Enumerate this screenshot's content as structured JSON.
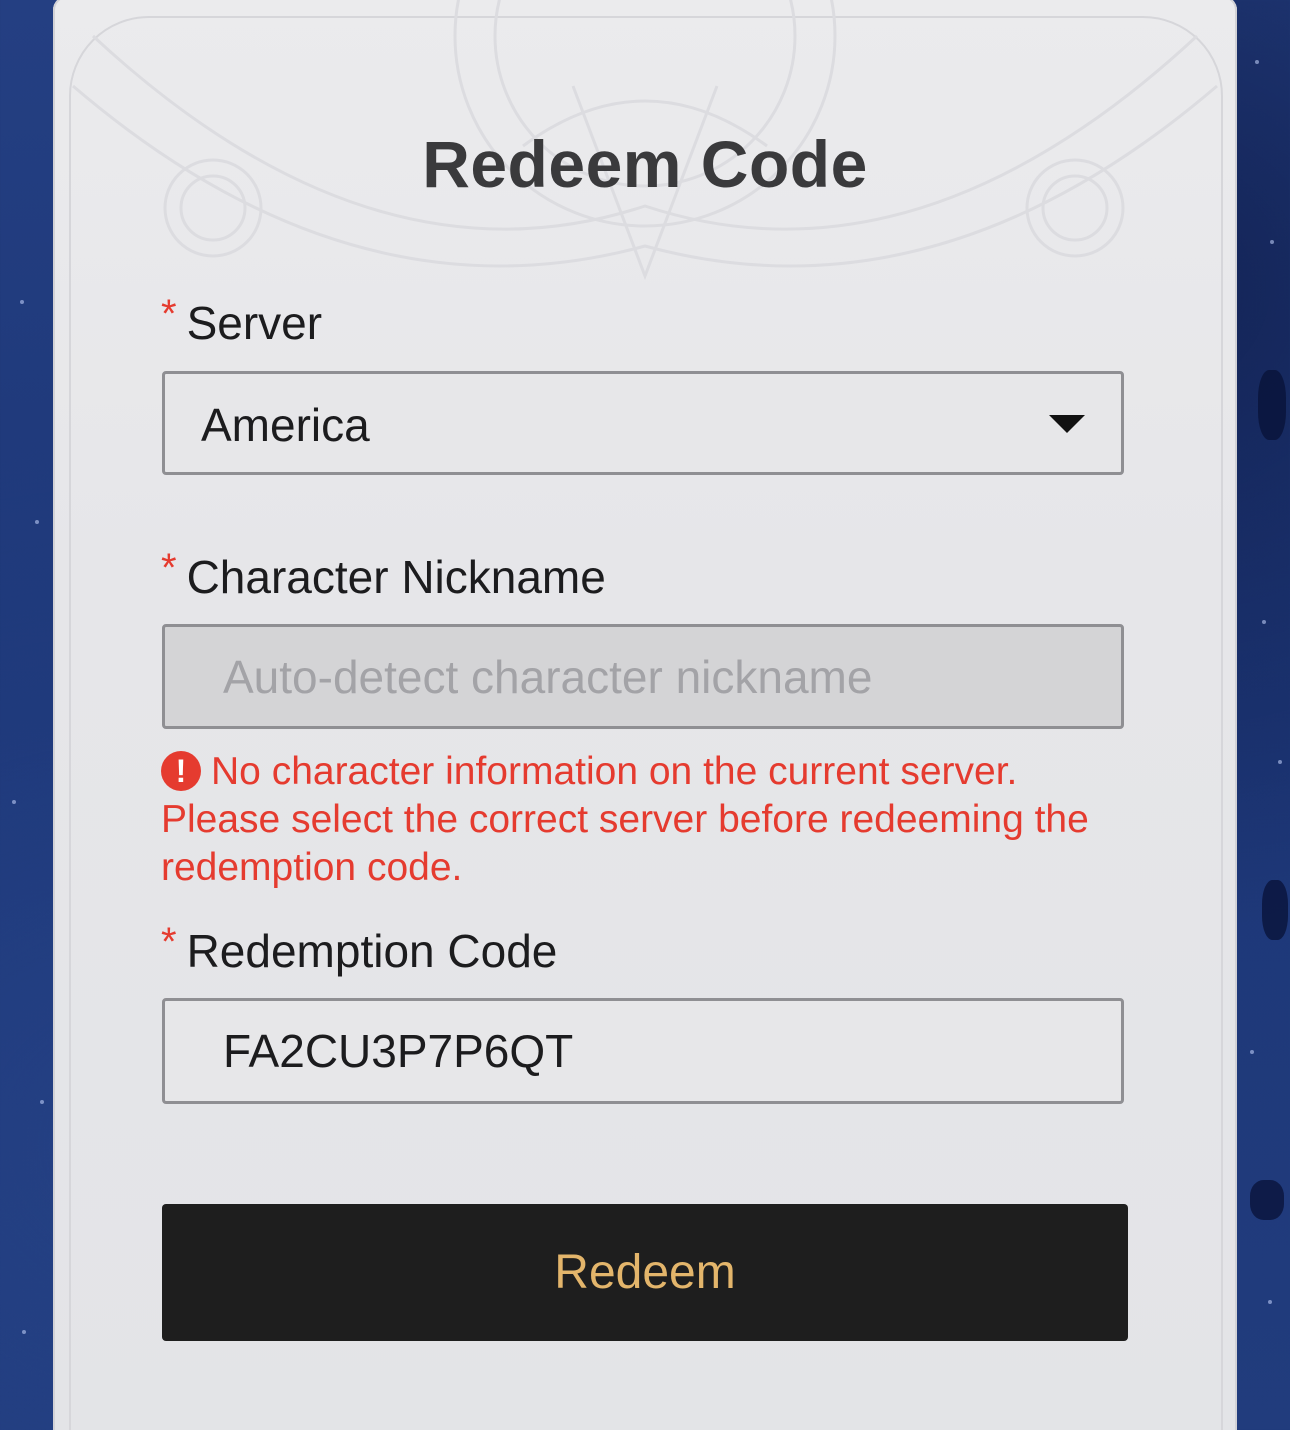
{
  "page": {
    "title": "Redeem Code"
  },
  "form": {
    "server": {
      "required_mark": "*",
      "label": "Server",
      "selected_value": "America"
    },
    "nickname": {
      "required_mark": "*",
      "label": "Character Nickname",
      "placeholder": "Auto-detect character nickname",
      "value": ""
    },
    "error": {
      "icon": "!",
      "message": "No character information on the current server. Please select the correct server before redeeming the redemption code."
    },
    "code": {
      "required_mark": "*",
      "label": "Redemption Code",
      "value": "FA2CU3P7P6QT"
    },
    "submit_label": "Redeem"
  },
  "colors": {
    "required": "#e53b2f",
    "error": "#e53b2f",
    "button_bg": "#1e1e1e",
    "button_text": "#e3b56b",
    "backdrop": "#1f3a7a"
  }
}
